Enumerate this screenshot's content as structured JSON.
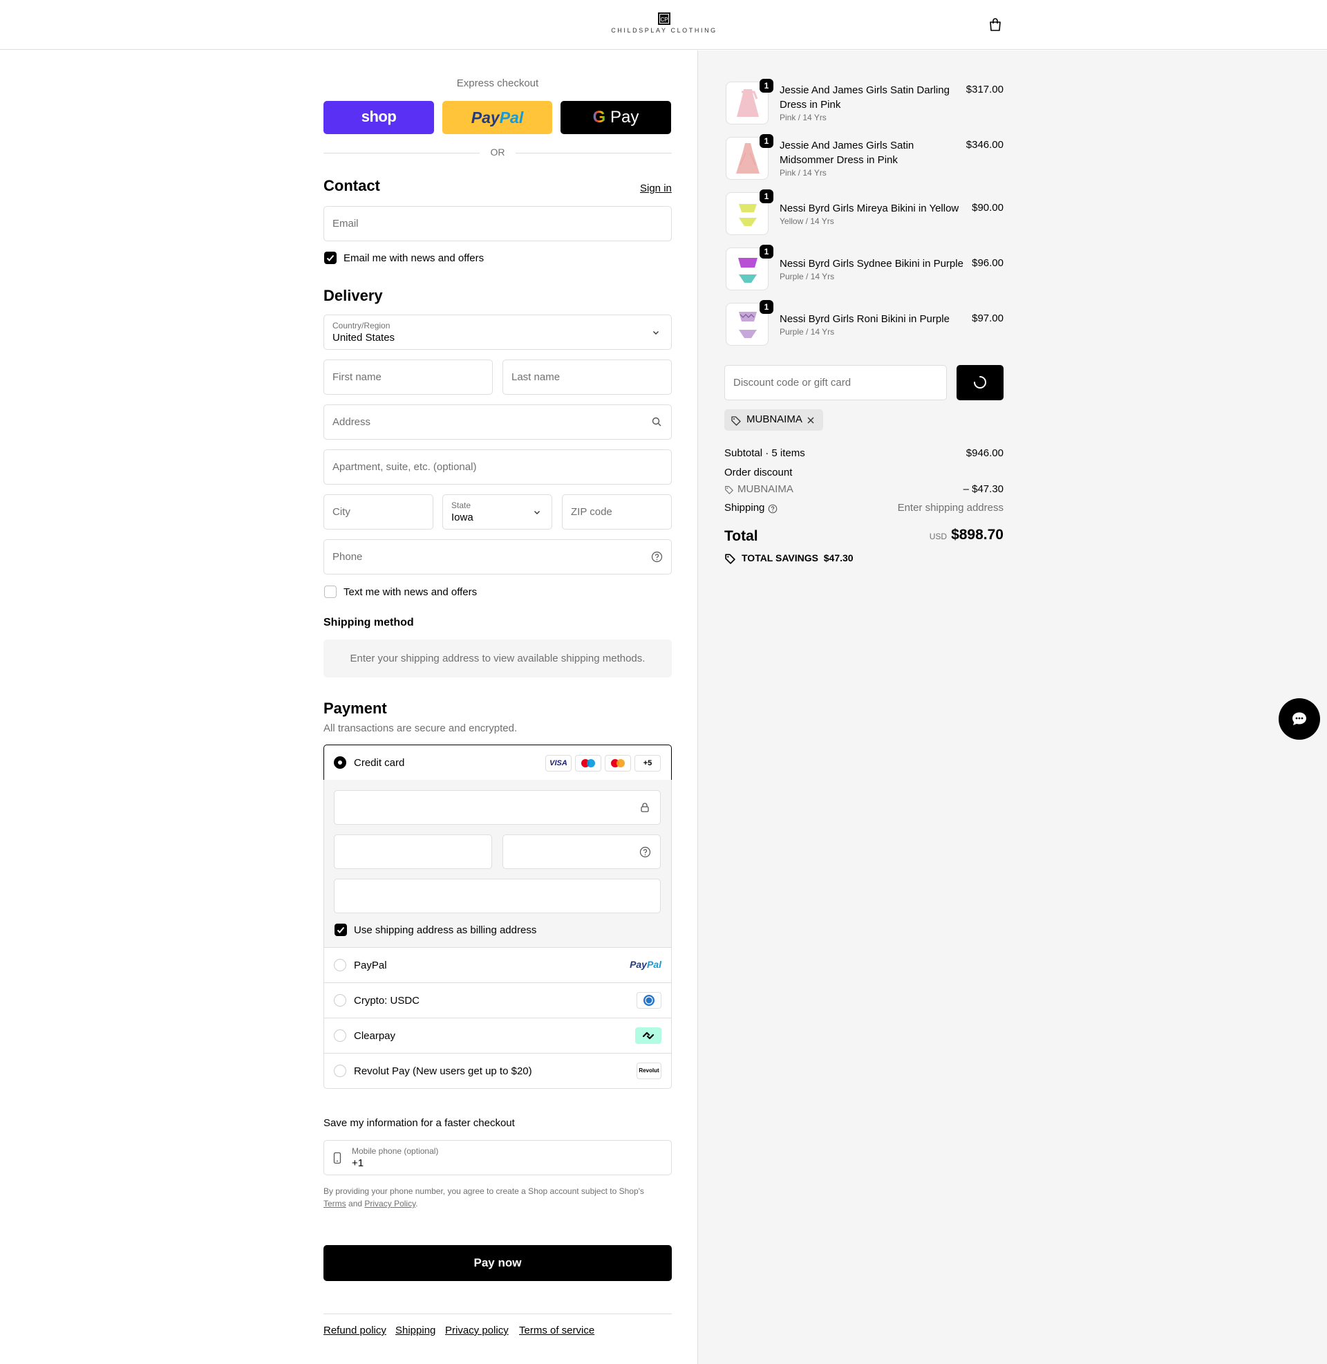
{
  "header": {
    "logo_mark": "CP",
    "logo_text": "CHILDSPLAY CLOTHING",
    "cart_icon": "bag-icon"
  },
  "express": {
    "title": "Express checkout",
    "shop_label": "shop",
    "paypal_label": "PayPal",
    "gpay_label": "Pay",
    "or_label": "OR"
  },
  "contact": {
    "title": "Contact",
    "sign_in": "Sign in",
    "email_placeholder": "Email",
    "news_label": "Email me with news and offers",
    "news_checked": true
  },
  "delivery": {
    "title": "Delivery",
    "country_label": "Country/Region",
    "country_value": "United States",
    "first_name": "First name",
    "last_name": "Last name",
    "address": "Address",
    "apartment": "Apartment, suite, etc. (optional)",
    "city": "City",
    "state_label": "State",
    "state_value": "Iowa",
    "zip": "ZIP code",
    "phone": "Phone",
    "text_label": "Text me with news and offers",
    "text_checked": false
  },
  "shipping_method": {
    "title": "Shipping method",
    "message": "Enter your shipping address to view available shipping methods."
  },
  "payment": {
    "title": "Payment",
    "subtitle": "All transactions are secure and encrypted.",
    "credit_card_label": "Credit card",
    "card_brands": [
      "VISA",
      "Maestro",
      "Mastercard"
    ],
    "more_brands": "+5",
    "billing_label": "Use shipping address as billing address",
    "billing_checked": true,
    "options": [
      {
        "label": "PayPal",
        "logo": "PayPal"
      },
      {
        "label": "Crypto: USDC",
        "logo": "usdc-icon"
      },
      {
        "label": "Clearpay",
        "logo": "clearpay-icon"
      },
      {
        "label": "Revolut Pay (New users get up to $20)",
        "logo": "Revolut"
      }
    ]
  },
  "save_info": {
    "title": "Save my information for a faster checkout",
    "phone_label": "Mobile phone (optional)",
    "phone_value": "+1",
    "legal_prefix": "By providing your phone number, you agree to create a Shop account subject to Shop's",
    "terms": "Terms",
    "and": "and",
    "privacy": "Privacy Policy",
    "period": "."
  },
  "pay_button": "Pay now",
  "footer_links": [
    "Refund policy",
    "Shipping",
    "Privacy policy",
    "Terms of service"
  ],
  "order": {
    "items": [
      {
        "name": "Jessie And James Girls Satin Darling Dress in Pink",
        "variant": "Pink / 14 Yrs",
        "price": "$317.00",
        "qty": "1",
        "color": "#f3c3cc"
      },
      {
        "name": "Jessie And James Girls Satin Midsommer Dress in Pink",
        "variant": "Pink / 14 Yrs",
        "price": "$346.00",
        "qty": "1",
        "color": "#efb7b4"
      },
      {
        "name": "Nessi Byrd Girls Mireya Bikini in Yellow",
        "variant": "Yellow / 14 Yrs",
        "price": "$90.00",
        "qty": "1",
        "color": "#dfe86a"
      },
      {
        "name": "Nessi Byrd Girls Sydnee Bikini in Purple",
        "variant": "Purple / 14 Yrs",
        "price": "$96.00",
        "qty": "1",
        "color": "#b84fd4"
      },
      {
        "name": "Nessi Byrd Girls Roni Bikini in Purple",
        "variant": "Purple / 14 Yrs",
        "price": "$97.00",
        "qty": "1",
        "color": "#c7a6d9"
      }
    ],
    "discount_placeholder": "Discount code or gift card",
    "applied_code": "MUBNAIMA",
    "subtotal_label": "Subtotal · 5 items",
    "subtotal_value": "$946.00",
    "order_discount_label": "Order discount",
    "discount_code": "MUBNAIMA",
    "discount_value": "– $47.30",
    "shipping_label": "Shipping",
    "shipping_value": "Enter shipping address",
    "total_label": "Total",
    "currency": "USD",
    "total_value": "$898.70",
    "savings_label": "TOTAL SAVINGS",
    "savings_value": "$47.30"
  },
  "colors": {
    "shop_purple": "#5a31f4",
    "paypal_yellow": "#ffc439",
    "paypal_dark": "#253b80",
    "paypal_light": "#179bd7",
    "clearpay_mint": "#b2fce4"
  }
}
